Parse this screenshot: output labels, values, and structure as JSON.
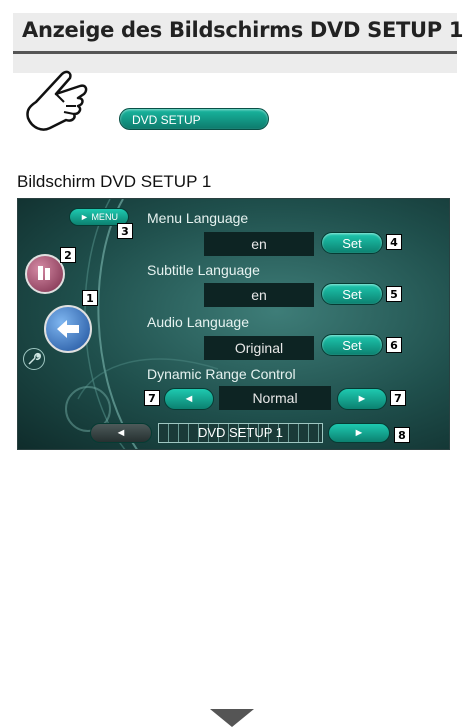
{
  "header": {
    "title": "Anzeige des Bildschirms DVD SETUP 1"
  },
  "intro": {
    "setup_button_label": "DVD SETUP"
  },
  "section": {
    "subheading": "Bildschirm DVD SETUP 1"
  },
  "screen": {
    "menu_button_label": "► MENU",
    "rows": [
      {
        "label": "Menu Language",
        "value": "en",
        "button": "Set"
      },
      {
        "label": "Subtitle Language",
        "value": "en",
        "button": "Set"
      },
      {
        "label": "Audio Language",
        "value": "Original",
        "button": "Set"
      }
    ],
    "drc": {
      "label": "Dynamic Range Control",
      "value": "Normal",
      "left_arrow": "◄",
      "right_arrow": "►"
    },
    "pager": {
      "title": "DVD SETUP 1",
      "prev": "◄",
      "next": "►"
    }
  },
  "callouts": [
    "1",
    "2",
    "3",
    "4",
    "5",
    "6",
    "7",
    "7",
    "8"
  ],
  "colors": {
    "accent": "#14a08c",
    "screen_bg": "#2b5e5a"
  }
}
